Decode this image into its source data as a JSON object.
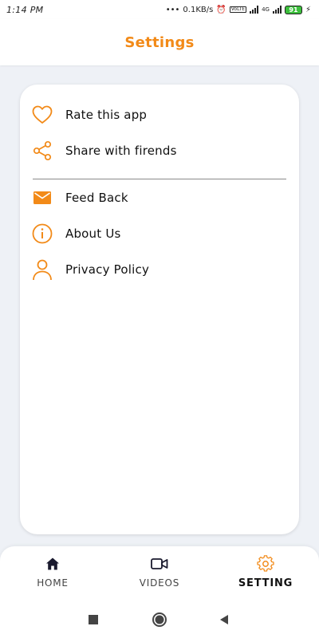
{
  "status_bar": {
    "time": "1:14 PM",
    "net_speed": "0.1KB/s",
    "network_badge_1": "VoLTE",
    "network_badge_2": "4G",
    "battery": "91"
  },
  "header": {
    "title": "Settings"
  },
  "menu": {
    "items": [
      {
        "label": "Rate this app",
        "icon": "heart-icon"
      },
      {
        "label": "Share with firends",
        "icon": "share-icon"
      },
      {
        "label": "Feed Back",
        "icon": "mail-icon"
      },
      {
        "label": "About Us",
        "icon": "info-icon"
      },
      {
        "label": "Privacy Policy",
        "icon": "person-icon"
      }
    ]
  },
  "bottom_nav": {
    "items": [
      {
        "label": "HOME",
        "icon": "home-icon"
      },
      {
        "label": "VIDEOS",
        "icon": "video-camera-icon"
      },
      {
        "label": "SETTING",
        "icon": "gear-icon",
        "active": true
      }
    ]
  },
  "colors": {
    "accent": "#f28a18",
    "background": "#eef1f6",
    "card": "#ffffff"
  }
}
